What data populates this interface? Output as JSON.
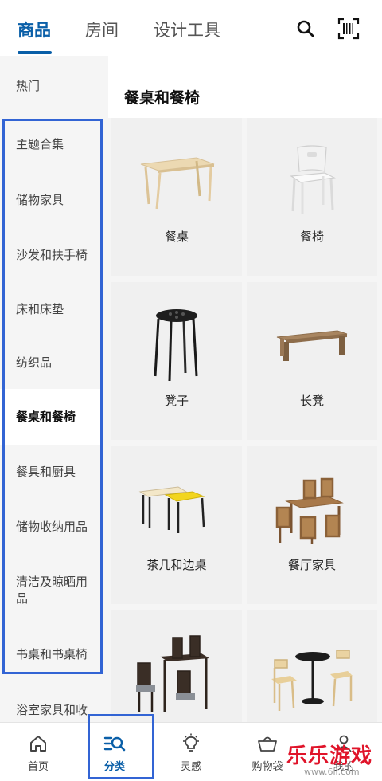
{
  "top_tabs": [
    {
      "label": "商品",
      "active": true
    },
    {
      "label": "房间",
      "active": false
    },
    {
      "label": "设计工具",
      "active": false
    }
  ],
  "top_icons": [
    "search-icon",
    "barcode-scan-icon"
  ],
  "sidebar": {
    "items": [
      {
        "label": "热门",
        "active": false
      },
      {
        "label": "主题合集",
        "active": false
      },
      {
        "label": "储物家具",
        "active": false
      },
      {
        "label": "沙发和扶手椅",
        "active": false
      },
      {
        "label": "床和床垫",
        "active": false
      },
      {
        "label": "纺织品",
        "active": false
      },
      {
        "label": "餐桌和餐椅",
        "active": true
      },
      {
        "label": "餐具和厨具",
        "active": false
      },
      {
        "label": "储物收纳用品",
        "active": false
      },
      {
        "label": "清洁及晾晒用品",
        "active": false
      },
      {
        "label": "书桌和书桌椅",
        "active": false
      },
      {
        "label": "浴室家具和收",
        "active": false
      }
    ]
  },
  "main": {
    "section_title": "餐桌和餐椅",
    "cards": [
      {
        "label": "餐桌",
        "image": "dining-table"
      },
      {
        "label": "餐椅",
        "image": "dining-chair"
      },
      {
        "label": "凳子",
        "image": "stool"
      },
      {
        "label": "长凳",
        "image": "bench"
      },
      {
        "label": "茶几和边桌",
        "image": "side-tables"
      },
      {
        "label": "餐厅家具",
        "image": "dining-set"
      },
      {
        "label": "",
        "image": "bar-table-set"
      },
      {
        "label": "",
        "image": "cafe-table-set"
      }
    ]
  },
  "bottom_nav": [
    {
      "label": "首页",
      "icon": "home-icon",
      "active": false
    },
    {
      "label": "分类",
      "icon": "category-search-icon",
      "active": true
    },
    {
      "label": "灵感",
      "icon": "lightbulb-icon",
      "active": false
    },
    {
      "label": "购物袋",
      "icon": "shopping-bag-icon",
      "active": false
    },
    {
      "label": "我的",
      "icon": "profile-icon",
      "active": false
    }
  ],
  "watermark": {
    "text": "乐乐游戏",
    "url": "www.6ll.com"
  },
  "colors": {
    "accent": "#0a5fa8",
    "highlight": "#3264d4",
    "watermark": "#e0142a"
  }
}
